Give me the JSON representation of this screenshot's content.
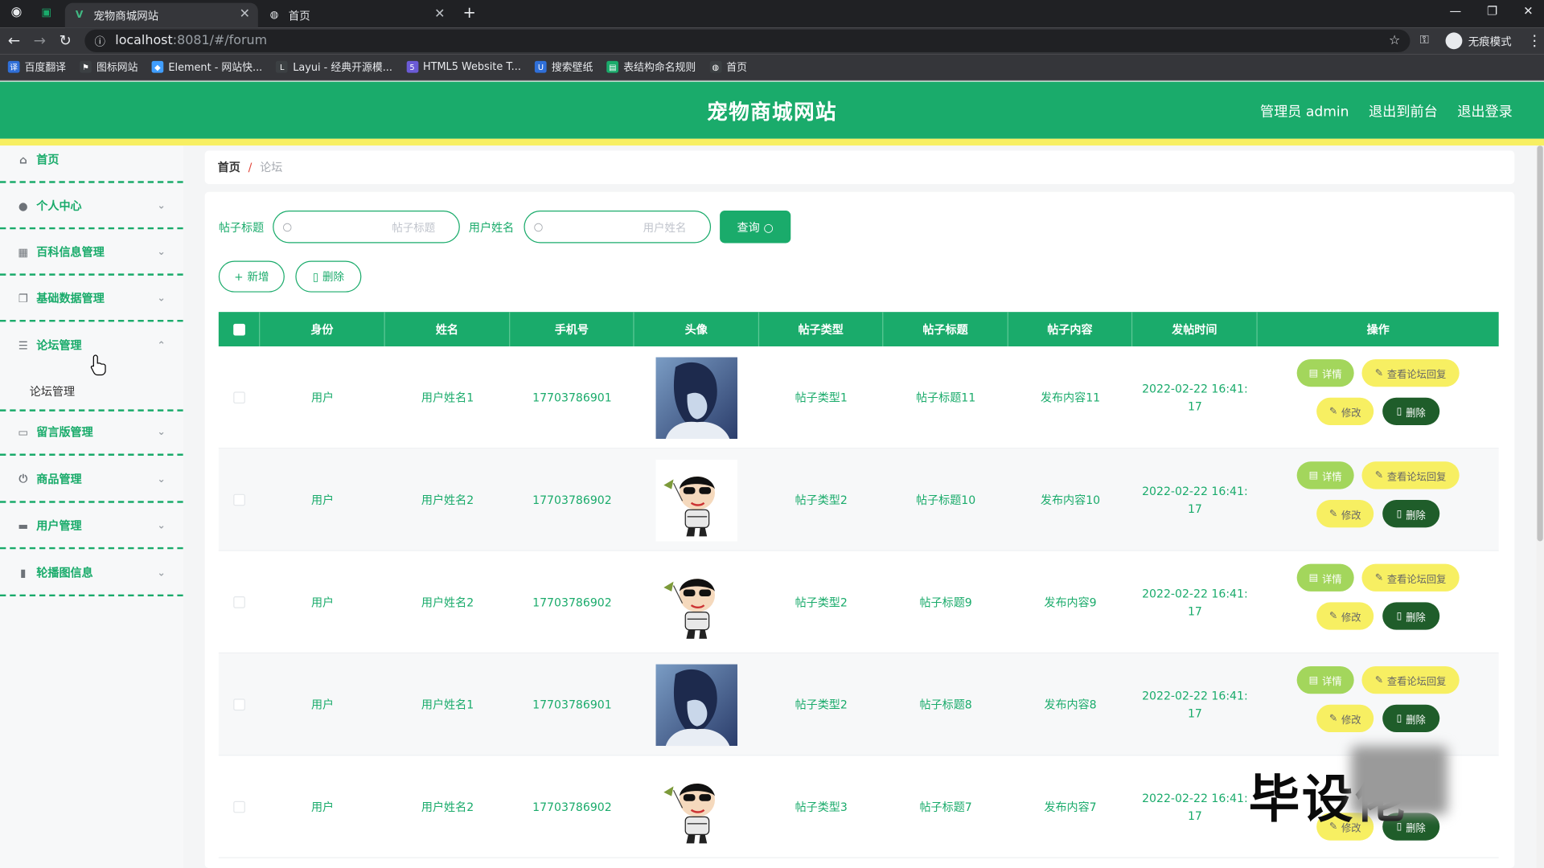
{
  "browser": {
    "tabs": [
      {
        "title": "宠物商城网站",
        "active": true
      },
      {
        "title": "首页",
        "active": false
      }
    ],
    "new_tab": "+",
    "url_host": "localhost",
    "url_rest": ":8081/#/forum",
    "profile_label": "无痕模式",
    "bookmarks": [
      {
        "label": "百度翻译",
        "color": "#2f6fd8"
      },
      {
        "label": "图标网站",
        "color": "#3c4043"
      },
      {
        "label": "Element - 网站快...",
        "color": "#409eff"
      },
      {
        "label": "Layui - 经典开源模...",
        "color": "#3c4043"
      },
      {
        "label": "HTML5 Website T...",
        "color": "#6b5bd6"
      },
      {
        "label": "搜索壁纸",
        "color": "#2f6fd8"
      },
      {
        "label": "表结构命名规则",
        "color": "#1aab6b"
      },
      {
        "label": "首页",
        "color": "#3c4043"
      }
    ]
  },
  "app": {
    "title": "宠物商城网站",
    "header_links": [
      "管理员 admin",
      "退出到前台",
      "退出登录"
    ]
  },
  "sidebar": {
    "items": [
      {
        "label": "首页",
        "icon": "home-icon",
        "has_chevron": false
      },
      {
        "label": "个人中心",
        "icon": "user-icon",
        "has_chevron": true
      },
      {
        "label": "百科信息管理",
        "icon": "clipboard-icon",
        "has_chevron": true
      },
      {
        "label": "基础数据管理",
        "icon": "copy-icon",
        "has_chevron": true
      },
      {
        "label": "论坛管理",
        "icon": "sliders-icon",
        "has_chevron": true,
        "expanded": true
      },
      {
        "label": "留言版管理",
        "icon": "chat-icon",
        "has_chevron": true
      },
      {
        "label": "商品管理",
        "icon": "power-icon",
        "has_chevron": true
      },
      {
        "label": "用户管理",
        "icon": "briefcase-icon",
        "has_chevron": true
      },
      {
        "label": "轮播图信息",
        "icon": "bar-chart-icon",
        "has_chevron": true
      }
    ],
    "submenu_label": "论坛管理"
  },
  "breadcrumb": {
    "home": "首页",
    "separator": "/",
    "current": "论坛"
  },
  "search": {
    "title_label": "帖子标题",
    "title_placeholder": "帖子标题",
    "user_label": "用户姓名",
    "user_placeholder": "用户姓名",
    "query_button": "查询"
  },
  "actions": {
    "add": "新增",
    "delete": "删除"
  },
  "table": {
    "columns": [
      "身份",
      "姓名",
      "手机号",
      "头像",
      "帖子类型",
      "帖子标题",
      "帖子内容",
      "发帖时间",
      "操作"
    ],
    "buttons": {
      "detail": "详情",
      "reply": "查看论坛回复",
      "edit": "修改",
      "delete": "删除"
    },
    "rows": [
      {
        "identity": "用户",
        "name": "用户姓名1",
        "phone": "17703786901",
        "avatar": "anime-boy-avatar",
        "type": "帖子类型1",
        "title": "帖子标题11",
        "content": "发布内容11",
        "time": "2022-02-22 16:41:17"
      },
      {
        "identity": "用户",
        "name": "用户姓名2",
        "phone": "17703786902",
        "avatar": "cartoon-kid-avatar",
        "type": "帖子类型2",
        "title": "帖子标题10",
        "content": "发布内容10",
        "time": "2022-02-22 16:41:17"
      },
      {
        "identity": "用户",
        "name": "用户姓名2",
        "phone": "17703786902",
        "avatar": "cartoon-kid-avatar",
        "type": "帖子类型2",
        "title": "帖子标题9",
        "content": "发布内容9",
        "time": "2022-02-22 16:41:17"
      },
      {
        "identity": "用户",
        "name": "用户姓名1",
        "phone": "17703786901",
        "avatar": "anime-boy-avatar",
        "type": "帖子类型2",
        "title": "帖子标题8",
        "content": "发布内容8",
        "time": "2022-02-22 16:41:17"
      },
      {
        "identity": "用户",
        "name": "用户姓名2",
        "phone": "17703786902",
        "avatar": "cartoon-kid-avatar",
        "type": "帖子类型3",
        "title": "帖子标题7",
        "content": "发布内容7",
        "time": "2022-02-22 16:41:17"
      }
    ]
  },
  "watermark": "毕设佬",
  "colors": {
    "primary": "#1aab6b",
    "accent_yellow": "#f7ef62",
    "light_green": "#a3d65c",
    "dark_green": "#1f5d2a"
  }
}
